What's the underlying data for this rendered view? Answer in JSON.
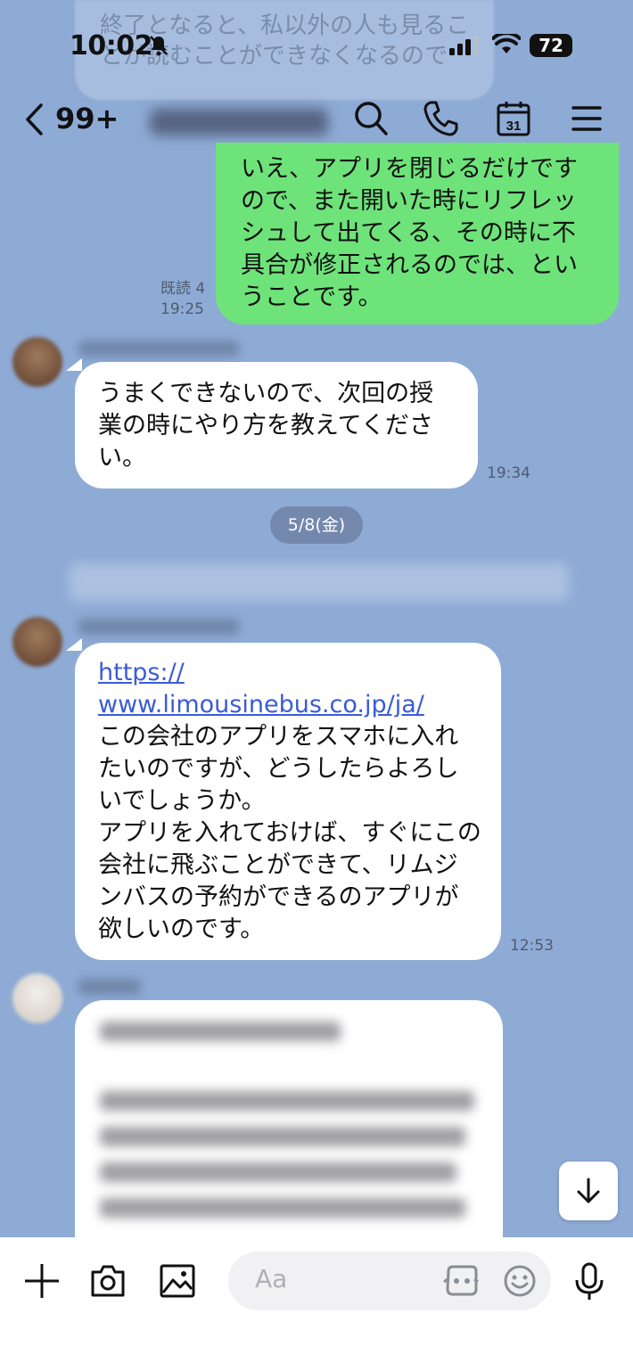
{
  "status": {
    "time": "10:02",
    "battery": "72"
  },
  "ghost": {
    "text": "終了となると、私以外の人も見ることが読むことができなくなるので"
  },
  "header": {
    "unread": "99+"
  },
  "messages": {
    "m1": {
      "text": "いえ、アプリを閉じるだけですので、また開いた時にリフレッシュして出てくる、その時に不具合が修正されるのでは、ということです。",
      "read": "既読 4",
      "time": "19:25"
    },
    "m2": {
      "text": "うまくできないので、次回の授業の時にやり方を教えてください。",
      "time": "19:34"
    },
    "date": "5/8(金)",
    "m3": {
      "link_line1": "https://",
      "link_line2": "www.limousinebus.co.jp/ja/",
      "text": "この会社のアプリをスマホに入れたいのですが、どうしたらよろしいでしょうか。\nアプリを入れておけば、すぐにこの会社に飛ぶことができて、リムジンバスの予約ができるのアプリが欲しいのです。",
      "time": "12:53"
    }
  },
  "input": {
    "placeholder": "Aa"
  },
  "colors": {
    "chat_bg": "#8eabd6",
    "my_bubble": "#6ee37a",
    "link": "#3a5bd9"
  }
}
